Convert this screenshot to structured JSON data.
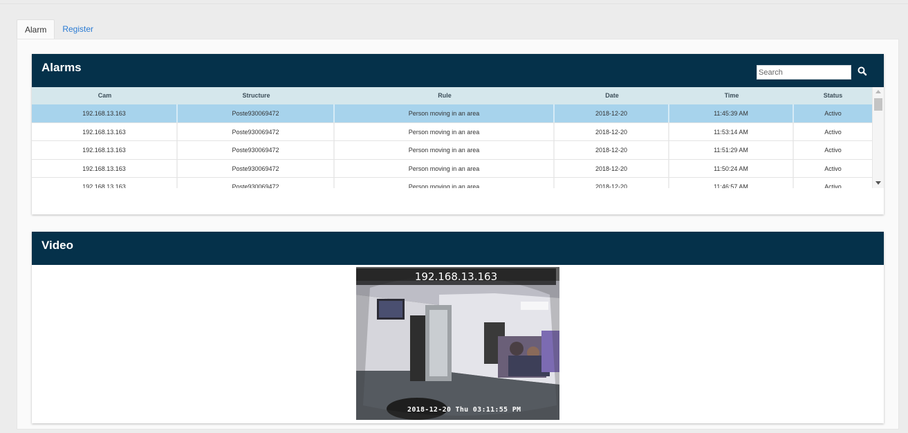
{
  "tabs": [
    {
      "label": "Alarm",
      "active": true
    },
    {
      "label": "Register",
      "active": false
    }
  ],
  "alarms": {
    "title": "Alarms",
    "search_placeholder": "Search",
    "columns": [
      "Cam",
      "Structure",
      "Rule",
      "Date",
      "Time",
      "Status"
    ],
    "rows": [
      [
        "192.168.13.163",
        "Poste930069472",
        "Person moving in an area",
        "2018-12-20",
        "11:45:39 AM",
        "Activo"
      ],
      [
        "192.168.13.163",
        "Poste930069472",
        "Person moving in an area",
        "2018-12-20",
        "11:53:14 AM",
        "Activo"
      ],
      [
        "192.168.13.163",
        "Poste930069472",
        "Person moving in an area",
        "2018-12-20",
        "11:51:29 AM",
        "Activo"
      ],
      [
        "192.168.13.163",
        "Poste930069472",
        "Person moving in an area",
        "2018-12-20",
        "11:50:24 AM",
        "Activo"
      ],
      [
        "192.168.13.163",
        "Poste930069472",
        "Person moving in an area",
        "2018-12-20",
        "11:46:57 AM",
        "Activo"
      ]
    ],
    "selected_row": 0
  },
  "video": {
    "title": "Video",
    "camera_label": "192.168.13.163",
    "timestamp": "2018-12-20 Thu 03:11:55 PM"
  },
  "colors": {
    "header_bg": "#05314a",
    "table_header_bg": "#d5e7ec",
    "selected_row_bg": "#a7d3ec",
    "tab_link": "#2a7bd3"
  },
  "icons": {
    "search": "search-icon",
    "scroll_up": "chevron-up-icon",
    "scroll_down": "chevron-down-icon"
  }
}
